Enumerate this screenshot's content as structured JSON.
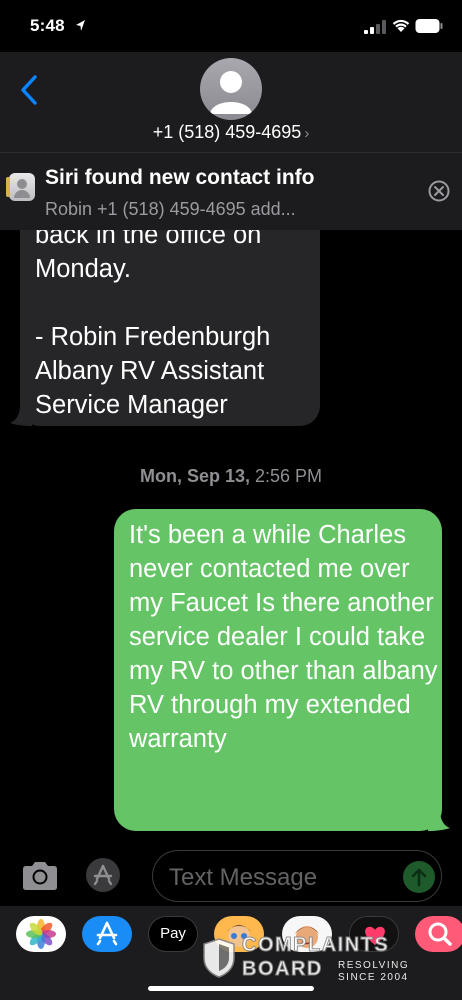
{
  "status_bar": {
    "time": "5:48"
  },
  "header": {
    "contact_number": "+1 (518) 459-4695",
    "chevron": "›"
  },
  "siri_banner": {
    "title": "Siri found new contact info",
    "subtitle": "Robin +1 (518) 459-4695  add..."
  },
  "messages": {
    "incoming_text": "back in the office on\nMonday.\n\n - Robin Fredenburgh\nAlbany RV Assistant\nService Manager",
    "timestamp_day": "Mon, Sep 13,",
    "timestamp_time": "2:56 PM",
    "outgoing_text": "It's been a while Charles never contacted me over my Faucet Is there another service dealer I could take my RV to other than albany RV through my extended warranty"
  },
  "input": {
    "placeholder": "Text Message"
  },
  "app_strip": {
    "apple_pay_label": "Pay"
  },
  "watermark": {
    "line1": "COMPLAINTS",
    "line2": "BOARD",
    "tag1": "RESOLVING",
    "tag2": "SINCE 2004"
  },
  "colors": {
    "outgoing_bubble": "#65c466",
    "incoming_bubble": "#262628",
    "accent": "#0a84ff"
  },
  "icons": [
    "location-arrow-icon",
    "signal-icon",
    "wifi-icon",
    "battery-icon",
    "back-chevron-icon",
    "contact-avatar-icon",
    "contact-card-icon",
    "close-icon",
    "camera-icon",
    "app-store-icon",
    "send-arrow-icon",
    "photos-icon",
    "heart-icon",
    "search-icon"
  ]
}
